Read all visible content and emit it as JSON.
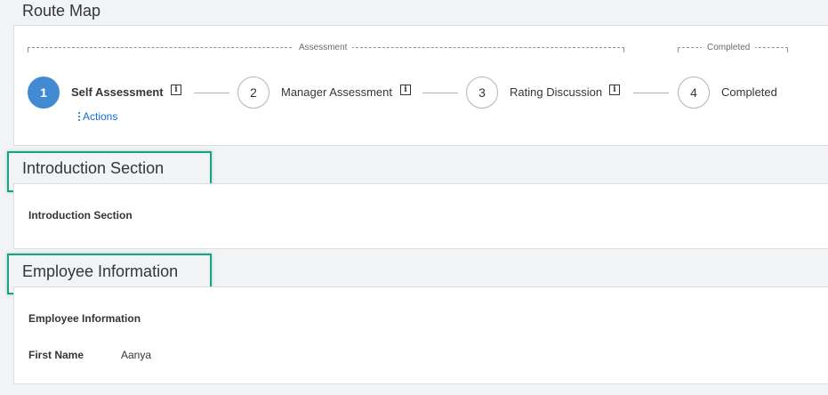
{
  "route_map": {
    "title": "Route Map",
    "phases": [
      {
        "label": "Assessment"
      },
      {
        "label": "Completed"
      }
    ],
    "steps": [
      {
        "number": "1",
        "label": "Self Assessment",
        "info": "i",
        "active": true
      },
      {
        "number": "2",
        "label": "Manager Assessment",
        "info": "i",
        "active": false
      },
      {
        "number": "3",
        "label": "Rating Discussion",
        "info": "i",
        "active": false
      },
      {
        "number": "4",
        "label": "Completed",
        "active": false
      }
    ],
    "actions_label": "Actions"
  },
  "introduction": {
    "title": "Introduction Section",
    "subtitle": "Introduction Section"
  },
  "employee_info": {
    "title": "Employee Information",
    "subtitle": "Employee Information",
    "fields": [
      {
        "label": "First Name",
        "value": "Aanya"
      }
    ]
  },
  "colors": {
    "active_step": "#428bd2",
    "link": "#0a6ed1",
    "highlight": "#16a283",
    "background": "#f2f3f5"
  }
}
